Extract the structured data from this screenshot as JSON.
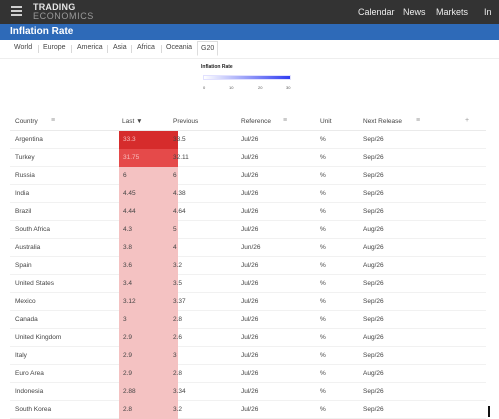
{
  "topbar": {
    "logo_line1": "TRADING",
    "logo_line2": "ECONOMICS",
    "nav": [
      "Calendar",
      "News",
      "Markets",
      "In"
    ]
  },
  "page_title": "Inflation Rate",
  "region_tabs": [
    "World",
    "Europe",
    "America",
    "Asia",
    "Africa",
    "Oceania",
    "G20"
  ],
  "active_tab": "G20",
  "legend": {
    "title": "Inflation Rate",
    "ticks": [
      "0",
      "10",
      "20",
      "30"
    ],
    "color_low": "#ffffff",
    "color_high": "#2f3cf2"
  },
  "table": {
    "columns": [
      "Country",
      "Last ▼",
      "Previous",
      "Reference",
      "Unit",
      "Next Release"
    ],
    "rows": [
      {
        "country": "Argentina",
        "last": "33.3",
        "previous": "33.5",
        "reference": "Jul/26",
        "unit": "%",
        "next_release": "Sep/26"
      },
      {
        "country": "Turkey",
        "last": "31.75",
        "previous": "32.11",
        "reference": "Jul/26",
        "unit": "%",
        "next_release": "Sep/26"
      },
      {
        "country": "Russia",
        "last": "6",
        "previous": "6",
        "reference": "Jul/26",
        "unit": "%",
        "next_release": "Sep/26"
      },
      {
        "country": "India",
        "last": "4.45",
        "previous": "4.38",
        "reference": "Jul/26",
        "unit": "%",
        "next_release": "Sep/26"
      },
      {
        "country": "Brazil",
        "last": "4.44",
        "previous": "4.64",
        "reference": "Jul/26",
        "unit": "%",
        "next_release": "Sep/26"
      },
      {
        "country": "South Africa",
        "last": "4.3",
        "previous": "5",
        "reference": "Jul/26",
        "unit": "%",
        "next_release": "Aug/26"
      },
      {
        "country": "Australia",
        "last": "3.8",
        "previous": "4",
        "reference": "Jun/26",
        "unit": "%",
        "next_release": "Aug/26"
      },
      {
        "country": "Spain",
        "last": "3.6",
        "previous": "3.2",
        "reference": "Jul/26",
        "unit": "%",
        "next_release": "Aug/26"
      },
      {
        "country": "United States",
        "last": "3.4",
        "previous": "3.5",
        "reference": "Jul/26",
        "unit": "%",
        "next_release": "Sep/26"
      },
      {
        "country": "Mexico",
        "last": "3.12",
        "previous": "3.37",
        "reference": "Jul/26",
        "unit": "%",
        "next_release": "Sep/26"
      },
      {
        "country": "Canada",
        "last": "3",
        "previous": "2.8",
        "reference": "Jul/26",
        "unit": "%",
        "next_release": "Sep/26"
      },
      {
        "country": "United Kingdom",
        "last": "2.9",
        "previous": "2.6",
        "reference": "Jul/26",
        "unit": "%",
        "next_release": "Aug/26"
      },
      {
        "country": "Italy",
        "last": "2.9",
        "previous": "3",
        "reference": "Jul/26",
        "unit": "%",
        "next_release": "Sep/26"
      },
      {
        "country": "Euro Area",
        "last": "2.9",
        "previous": "2.8",
        "reference": "Jul/26",
        "unit": "%",
        "next_release": "Aug/26"
      },
      {
        "country": "Indonesia",
        "last": "2.88",
        "previous": "3.34",
        "reference": "Jul/26",
        "unit": "%",
        "next_release": "Sep/26"
      },
      {
        "country": "South Korea",
        "last": "2.8",
        "previous": "3.2",
        "reference": "Jul/26",
        "unit": "%",
        "next_release": "Sep/26"
      }
    ]
  },
  "colors": {
    "topbar": "#333333",
    "title_bar": "#2e6ab8",
    "last_high": "#d62c2c",
    "last_mid": "#e54a4a",
    "last_low": "#f4c2c2"
  }
}
